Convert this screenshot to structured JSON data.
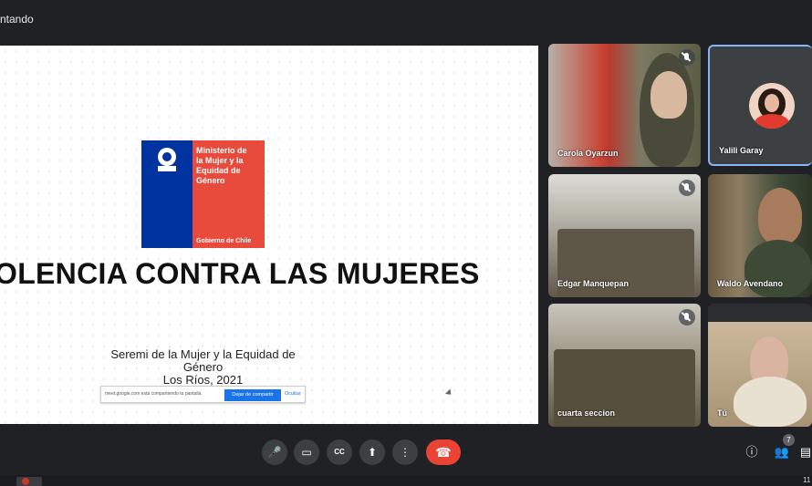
{
  "window": {
    "title": "ntando"
  },
  "slide": {
    "logo_lines": "Ministerio de\nla Mujer y la\nEquidad de\nGénero",
    "logo_gov": "Gobierno de Chile",
    "title": "OLENCIA CONTRA LAS MUJERES",
    "subtitle_line1": "Seremi de la Mujer y la Equidad de Género",
    "subtitle_line2": "Los Ríos, 2021",
    "share_banner": {
      "text": "meet.google.com está compartiendo tu pantalla.",
      "stop_label": "Dejar de compartir",
      "hide_label": "Ocultar"
    }
  },
  "participants": [
    {
      "name": "Carola Oyarzun",
      "muted": true
    },
    {
      "name": "Yalili Garay",
      "muted": false
    },
    {
      "name": "Edgar Manquepan",
      "muted": true
    },
    {
      "name": "Waldo Avendano",
      "muted": false
    },
    {
      "name": "cuarta seccion",
      "muted": true
    },
    {
      "name": "Tú",
      "muted": false
    }
  ],
  "controls": {
    "mic": "🎤",
    "camera": "▭",
    "captions": "CC",
    "present": "⬆",
    "more": "⋮",
    "hangup": "☎",
    "info": "ⓘ",
    "people": "👥",
    "chat": "▤",
    "people_count": "7"
  },
  "taskbar": {
    "time": "11"
  },
  "colors": {
    "accent": "#8ab4f8",
    "hangup": "#ea4335",
    "chile_blue": "#0033a0",
    "chile_red": "#e84b3c"
  }
}
